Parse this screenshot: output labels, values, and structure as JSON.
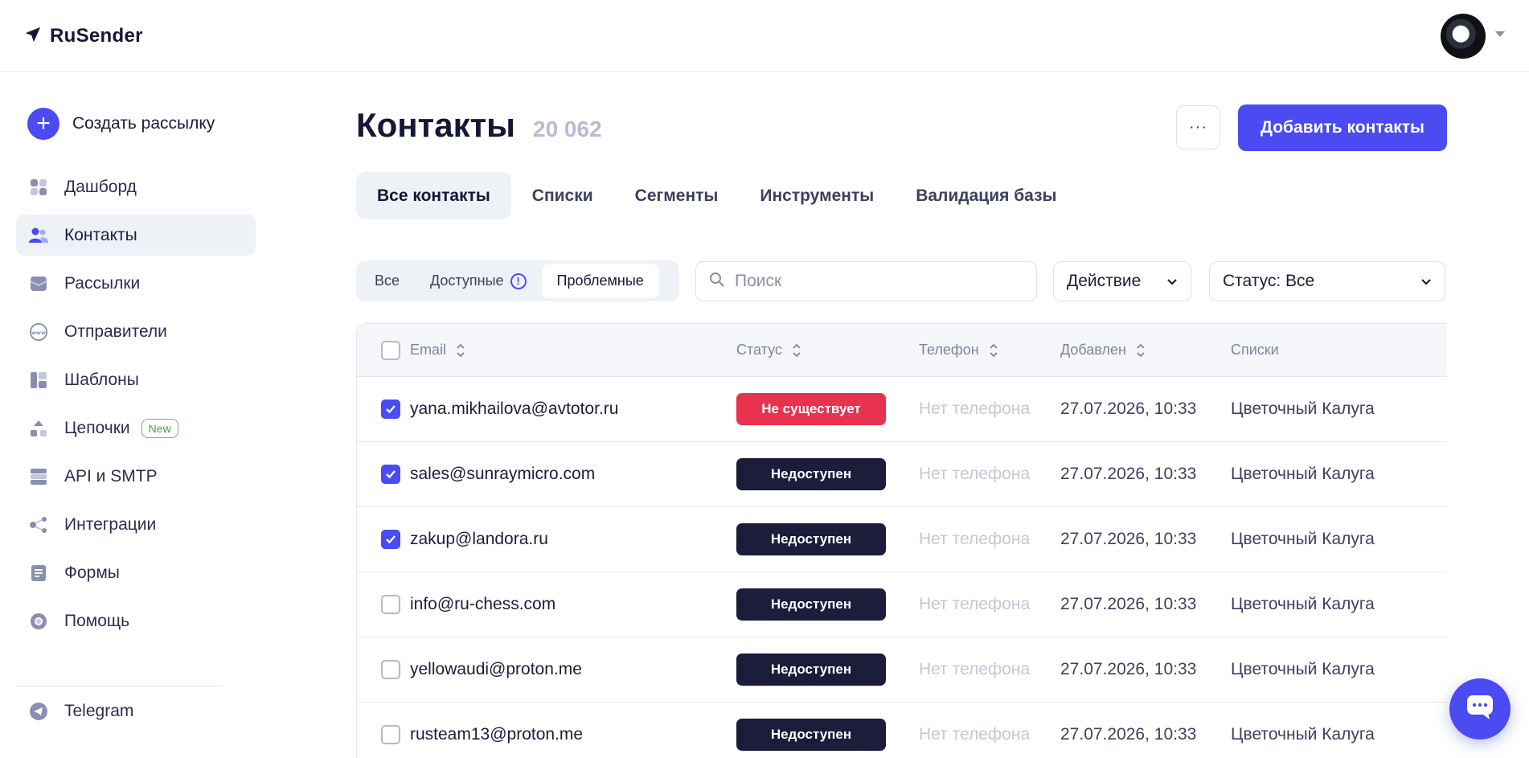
{
  "header": {
    "brand": "RuSender",
    "avatar_icon": "user-avatar-icon"
  },
  "sidebar": {
    "create_label": "Создать рассылку",
    "items": [
      {
        "label": "Дашборд",
        "icon": "dashboard-icon",
        "active": false
      },
      {
        "label": "Контакты",
        "icon": "contacts-icon",
        "active": true
      },
      {
        "label": "Рассылки",
        "icon": "mailbox-icon",
        "active": false
      },
      {
        "label": "Отправители",
        "icon": "www-icon",
        "active": false
      },
      {
        "label": "Шаблоны",
        "icon": "templates-icon",
        "active": false
      },
      {
        "label": "Цепочки",
        "icon": "chains-icon",
        "active": false,
        "badge": "New"
      },
      {
        "label": "API и SMTP",
        "icon": "server-icon",
        "active": false
      },
      {
        "label": "Интеграции",
        "icon": "integrations-icon",
        "active": false
      },
      {
        "label": "Формы",
        "icon": "forms-icon",
        "active": false
      },
      {
        "label": "Помощь",
        "icon": "help-icon",
        "active": false
      }
    ],
    "telegram_label": "Telegram"
  },
  "page": {
    "title": "Контакты",
    "count": "20 062",
    "more_label": "···",
    "add_label": "Добавить контакты"
  },
  "tabs": [
    "Все контакты",
    "Списки",
    "Сегменты",
    "Инструменты",
    "Валидация базы"
  ],
  "filters": {
    "segments": [
      "Все",
      "Доступные",
      "Проблемные"
    ],
    "active_segment": "Проблемные",
    "search_placeholder": "Поиск",
    "action_label": "Действие",
    "status_label": "Статус: Все"
  },
  "table": {
    "headers": {
      "email": "Email",
      "status": "Статус",
      "phone": "Телефон",
      "added": "Добавлен",
      "lists": "Списки"
    },
    "rows": [
      {
        "email": "yana.mikhailova@avtotor.ru",
        "status": "Не существует",
        "status_color": "#e8324e",
        "phone": "Нет телефона",
        "added": "27.07.2026, 10:33",
        "list": "Цветочный Калуга",
        "checked": true
      },
      {
        "email": "sales@sunraymicro.com",
        "status": "Недоступен",
        "status_color": "#1b1d3b",
        "phone": "Нет телефона",
        "added": "27.07.2026, 10:33",
        "list": "Цветочный Калуга",
        "checked": true
      },
      {
        "email": "zakup@landora.ru",
        "status": "Недоступен",
        "status_color": "#1b1d3b",
        "phone": "Нет телефона",
        "added": "27.07.2026, 10:33",
        "list": "Цветочный Калуга",
        "checked": true
      },
      {
        "email": "info@ru-chess.com",
        "status": "Недоступен",
        "status_color": "#1b1d3b",
        "phone": "Нет телефона",
        "added": "27.07.2026, 10:33",
        "list": "Цветочный Калуга",
        "checked": false
      },
      {
        "email": "yellowaudi@proton.me",
        "status": "Недоступен",
        "status_color": "#1b1d3b",
        "phone": "Нет телефона",
        "added": "27.07.2026, 10:33",
        "list": "Цветочный Калуга",
        "checked": false
      },
      {
        "email": "rusteam13@proton.me",
        "status": "Недоступен",
        "status_color": "#1b1d3b",
        "phone": "Нет телефона",
        "added": "27.07.2026, 10:33",
        "list": "Цветочный Калуга",
        "checked": false
      }
    ]
  },
  "colors": {
    "accent": "#4a4bf0",
    "danger": "#e8324e",
    "dark": "#1b1d3b"
  }
}
